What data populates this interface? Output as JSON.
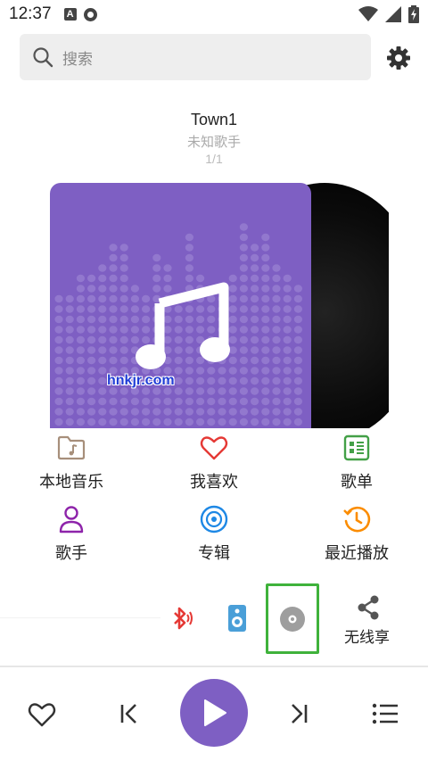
{
  "status_bar": {
    "time": "12:37",
    "left_icons": [
      "a-notification-icon",
      "disc-notification-icon"
    ],
    "right_icons": [
      "wifi-icon",
      "signal-icon",
      "battery-charging-icon"
    ]
  },
  "search": {
    "placeholder": "搜索"
  },
  "track": {
    "title": "Town1",
    "artist": "未知歌手",
    "index": "1/1"
  },
  "watermark": "hnkjr.com",
  "menu": [
    {
      "label": "本地音乐",
      "icon": "folder-music-icon",
      "color": "#a78f7b"
    },
    {
      "label": "我喜欢",
      "icon": "heart-icon",
      "color": "#e53935"
    },
    {
      "label": "歌单",
      "icon": "playlist-icon",
      "color": "#43a047"
    },
    {
      "label": "歌手",
      "icon": "person-icon",
      "color": "#8e24aa"
    },
    {
      "label": "专辑",
      "icon": "album-icon",
      "color": "#1e88e5"
    },
    {
      "label": "最近播放",
      "icon": "history-icon",
      "color": "#fb8c00"
    }
  ],
  "output": {
    "bluetooth_icon": "bluetooth-icon",
    "speaker_icon": "speaker-icon",
    "disc_icon": "disc-icon",
    "share_label": "无线享"
  },
  "colors": {
    "accent": "#7e5fc3",
    "highlight": "#3fb23b"
  }
}
